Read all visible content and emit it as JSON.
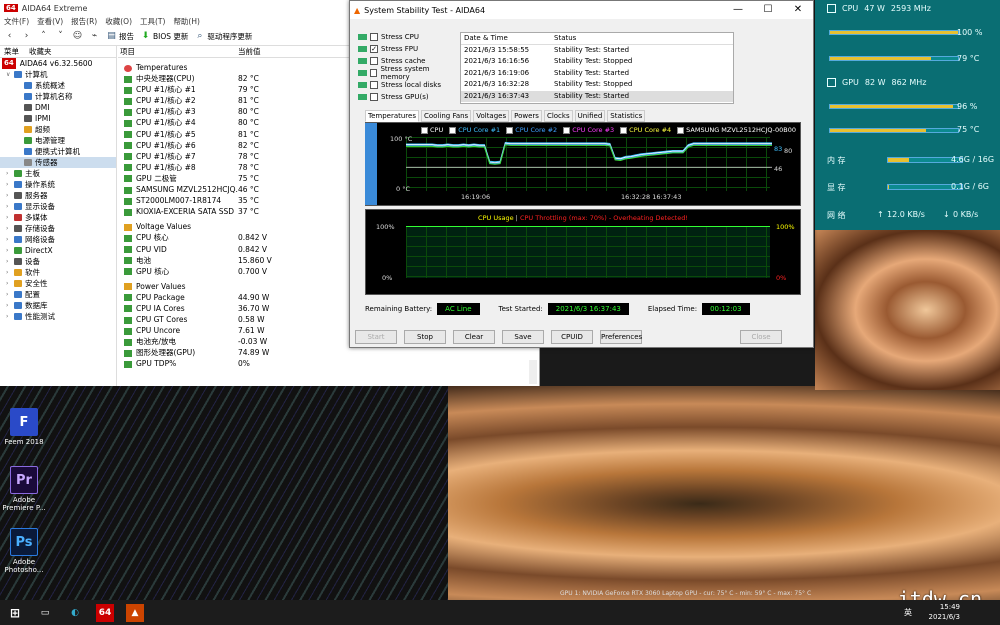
{
  "aida": {
    "title": "AIDA64 Extreme",
    "menu": [
      "文件(F)",
      "查看(V)",
      "报告(R)",
      "收藏(O)",
      "工具(T)",
      "帮助(H)"
    ],
    "toolbar": {
      "report": "报告",
      "bios": "BIOS 更新",
      "driver": "驱动程序更新"
    },
    "sidebar_tabs": [
      "菜单",
      "收藏夹"
    ],
    "version": "AIDA64 v6.32.5600",
    "tree": [
      {
        "label": "计算机",
        "indent": 1,
        "color": "#3a78c8"
      },
      {
        "label": "系统概述",
        "indent": 2,
        "color": "#3a78c8"
      },
      {
        "label": "计算机名称",
        "indent": 2,
        "color": "#3a78c8"
      },
      {
        "label": "DMI",
        "indent": 2,
        "color": "#555"
      },
      {
        "label": "IPMI",
        "indent": 2,
        "color": "#555"
      },
      {
        "label": "超频",
        "indent": 2,
        "color": "#e0a020"
      },
      {
        "label": "电源管理",
        "indent": 2,
        "color": "#3a9a3a"
      },
      {
        "label": "便携式计算机",
        "indent": 2,
        "color": "#3a78c8"
      },
      {
        "label": "传感器",
        "indent": 2,
        "color": "#888"
      },
      {
        "label": "主板",
        "indent": 1,
        "color": "#3a9a3a"
      },
      {
        "label": "操作系统",
        "indent": 1,
        "color": "#3a78c8"
      },
      {
        "label": "服务器",
        "indent": 1,
        "color": "#555"
      },
      {
        "label": "显示设备",
        "indent": 1,
        "color": "#3a78c8"
      },
      {
        "label": "多媒体",
        "indent": 1,
        "color": "#c03030"
      },
      {
        "label": "存储设备",
        "indent": 1,
        "color": "#555"
      },
      {
        "label": "网络设备",
        "indent": 1,
        "color": "#3a78c8"
      },
      {
        "label": "DirectX",
        "indent": 1,
        "color": "#3a9a3a"
      },
      {
        "label": "设备",
        "indent": 1,
        "color": "#555"
      },
      {
        "label": "软件",
        "indent": 1,
        "color": "#e0a020"
      },
      {
        "label": "安全性",
        "indent": 1,
        "color": "#e0a020"
      },
      {
        "label": "配置",
        "indent": 1,
        "color": "#3a78c8"
      },
      {
        "label": "数据库",
        "indent": 1,
        "color": "#3a78c8"
      },
      {
        "label": "性能测试",
        "indent": 1,
        "color": "#3a78c8"
      }
    ],
    "col_item": "项目",
    "col_value": "当前值",
    "temps_header": "Temperatures",
    "temps": [
      [
        "中央处理器(CPU)",
        "82 °C"
      ],
      [
        "CPU #1/核心 #1",
        "79 °C"
      ],
      [
        "CPU #1/核心 #2",
        "81 °C"
      ],
      [
        "CPU #1/核心 #3",
        "80 °C"
      ],
      [
        "CPU #1/核心 #4",
        "80 °C"
      ],
      [
        "CPU #1/核心 #5",
        "81 °C"
      ],
      [
        "CPU #1/核心 #6",
        "82 °C"
      ],
      [
        "CPU #1/核心 #7",
        "78 °C"
      ],
      [
        "CPU #1/核心 #8",
        "78 °C"
      ],
      [
        "GPU 二极管",
        "75 °C"
      ],
      [
        "SAMSUNG MZVL2512HCJQ...",
        "46 °C"
      ],
      [
        "ST2000LM007-1R8174",
        "35 °C"
      ],
      [
        "KIOXIA-EXCERIA SATA SSD",
        "37 °C"
      ]
    ],
    "volt_header": "Voltage Values",
    "volts": [
      [
        "CPU 核心",
        "0.842 V"
      ],
      [
        "CPU VID",
        "0.842 V"
      ],
      [
        "电池",
        "15.860 V"
      ],
      [
        "GPU 核心",
        "0.700 V"
      ]
    ],
    "power_header": "Power Values",
    "powers": [
      [
        "CPU Package",
        "44.90 W"
      ],
      [
        "CPU IA Cores",
        "36.70 W"
      ],
      [
        "CPU GT Cores",
        "0.58 W"
      ],
      [
        "CPU Uncore",
        "7.61 W"
      ],
      [
        "电池充/放电",
        "-0.03 W"
      ],
      [
        "图形处理器(GPU)",
        "74.89 W"
      ],
      [
        "GPU TDP%",
        "0%"
      ]
    ]
  },
  "sst": {
    "title": "System Stability Test - AIDA64",
    "stress": [
      {
        "label": "Stress CPU",
        "checked": false
      },
      {
        "label": "Stress FPU",
        "checked": true
      },
      {
        "label": "Stress cache",
        "checked": false
      },
      {
        "label": "Stress system memory",
        "checked": false
      },
      {
        "label": "Stress local disks",
        "checked": false
      },
      {
        "label": "Stress GPU(s)",
        "checked": false
      }
    ],
    "log_headers": [
      "Date & Time",
      "Status"
    ],
    "log": [
      [
        "2021/6/3 15:58:55",
        "Stability Test: Started"
      ],
      [
        "2021/6/3 16:16:56",
        "Stability Test: Stopped"
      ],
      [
        "2021/6/3 16:19:06",
        "Stability Test: Started"
      ],
      [
        "2021/6/3 16:32:28",
        "Stability Test: Stopped"
      ],
      [
        "2021/6/3 16:37:43",
        "Stability Test: Started"
      ]
    ],
    "tabs": [
      "Temperatures",
      "Cooling Fans",
      "Voltages",
      "Powers",
      "Clocks",
      "Unified",
      "Statistics"
    ],
    "legend": [
      {
        "label": "CPU",
        "color": "#ffffff"
      },
      {
        "label": "CPU Core #1",
        "color": "#40c0ff"
      },
      {
        "label": "CPU Core #2",
        "color": "#40a0ff"
      },
      {
        "label": "CPU Core #3",
        "color": "#ff40ff"
      },
      {
        "label": "CPU Core #4",
        "color": "#ffff40"
      },
      {
        "label": "SAMSUNG MZVL2512HCJQ-00B00",
        "color": "#ffffff"
      }
    ],
    "temp_top": "100 °C",
    "temp_bottom": "0 °C",
    "temp_right1": "83",
    "temp_right2": "80",
    "temp_right3": "46",
    "times_left": "16:19:06",
    "times_right": "16:32:28 16:37:43",
    "usage_title": "CPU Usage",
    "usage_sep": "|",
    "usage_throttle": "CPU Throttling (max: 70%) - Overheating Detected!",
    "usage_top_left": "100%",
    "usage_bottom_left": "0%",
    "usage_top_right": "100%",
    "usage_bottom_right": "0%",
    "remaining_battery_label": "Remaining Battery:",
    "remaining_battery": "AC Line",
    "test_started_label": "Test Started:",
    "test_started": "2021/6/3 16:37:43",
    "elapsed_label": "Elapsed Time:",
    "elapsed": "00:12:03",
    "buttons": [
      {
        "label": "Start",
        "disabled": true
      },
      {
        "label": "Stop",
        "disabled": false
      },
      {
        "label": "Clear",
        "disabled": false
      },
      {
        "label": "Save",
        "disabled": false
      },
      {
        "label": "CPUID",
        "disabled": false
      },
      {
        "label": "Preferences",
        "disabled": false
      },
      {
        "label": "Close",
        "disabled": true
      }
    ],
    "temp_series": {
      "core": [
        0.13,
        0.13,
        0.13,
        0.13,
        0.13,
        0.13,
        0.14,
        0.14,
        0.13,
        0.14,
        0.14,
        0.13,
        0.14,
        0.13,
        0.14,
        0.14,
        0.45,
        0.46,
        0.45,
        0.1,
        0.11,
        0.11,
        0.11,
        0.11,
        0.11,
        0.11,
        0.11,
        0.11,
        0.11,
        0.11,
        0.11,
        0.11,
        0.11,
        0.11,
        0.11,
        0.11,
        0.11,
        0.11,
        0.11,
        0.12,
        0.38,
        0.39,
        0.36,
        0.35,
        0.33,
        0.31,
        0.3,
        0.29,
        0.28,
        0.27,
        0.26,
        0.25,
        0.25,
        0.25,
        0.14,
        0.11,
        0.11,
        0.11,
        0.11,
        0.11,
        0.11,
        0.11,
        0.11,
        0.11,
        0.11,
        0.11,
        0.11,
        0.11,
        0.11,
        0.11,
        0.11
      ]
    }
  },
  "monitor": {
    "cpu_label": "CPU",
    "cpu_power": "47 W",
    "cpu_clock": "2593 MHz",
    "cpu_load": "100 %",
    "cpu_load_frac": 1.0,
    "cpu_temp": "79 °C",
    "cpu_temp_frac": 0.79,
    "gpu_label": "GPU",
    "gpu_power": "82 W",
    "gpu_clock": "862 MHz",
    "gpu_load": "96 %",
    "gpu_load_frac": 0.96,
    "gpu_temp": "75 °C",
    "gpu_temp_frac": 0.75,
    "mem_label": "内 存",
    "mem_value": "4.6G / 16G",
    "mem_frac": 0.29,
    "vram_label": "显 存",
    "vram_value": "0.1G / 6G",
    "vram_frac": 0.02,
    "net_label": "网 络",
    "net_up": "12.0 KB/s",
    "net_down": "0 KB/s"
  },
  "desktop": [
    {
      "label": "Feem 2018",
      "glyph": "F",
      "color": "#2a4ac8"
    },
    {
      "label": "Adobe Premiere P...",
      "glyph": "Pr",
      "color": "#1a0a3a"
    },
    {
      "label": "Adobe Photosho...",
      "glyph": "Ps",
      "color": "#0a1a3a"
    }
  ],
  "taskbar": {
    "time": "15:49",
    "date": "2021/6/3",
    "lang": "英"
  },
  "gpu_overlay": "GPU 1: NVIDIA GeForce RTX 3060 Laptop GPU - cur: 75° C - min: 59° C - max: 75° C",
  "watermark": "itdw.cn"
}
